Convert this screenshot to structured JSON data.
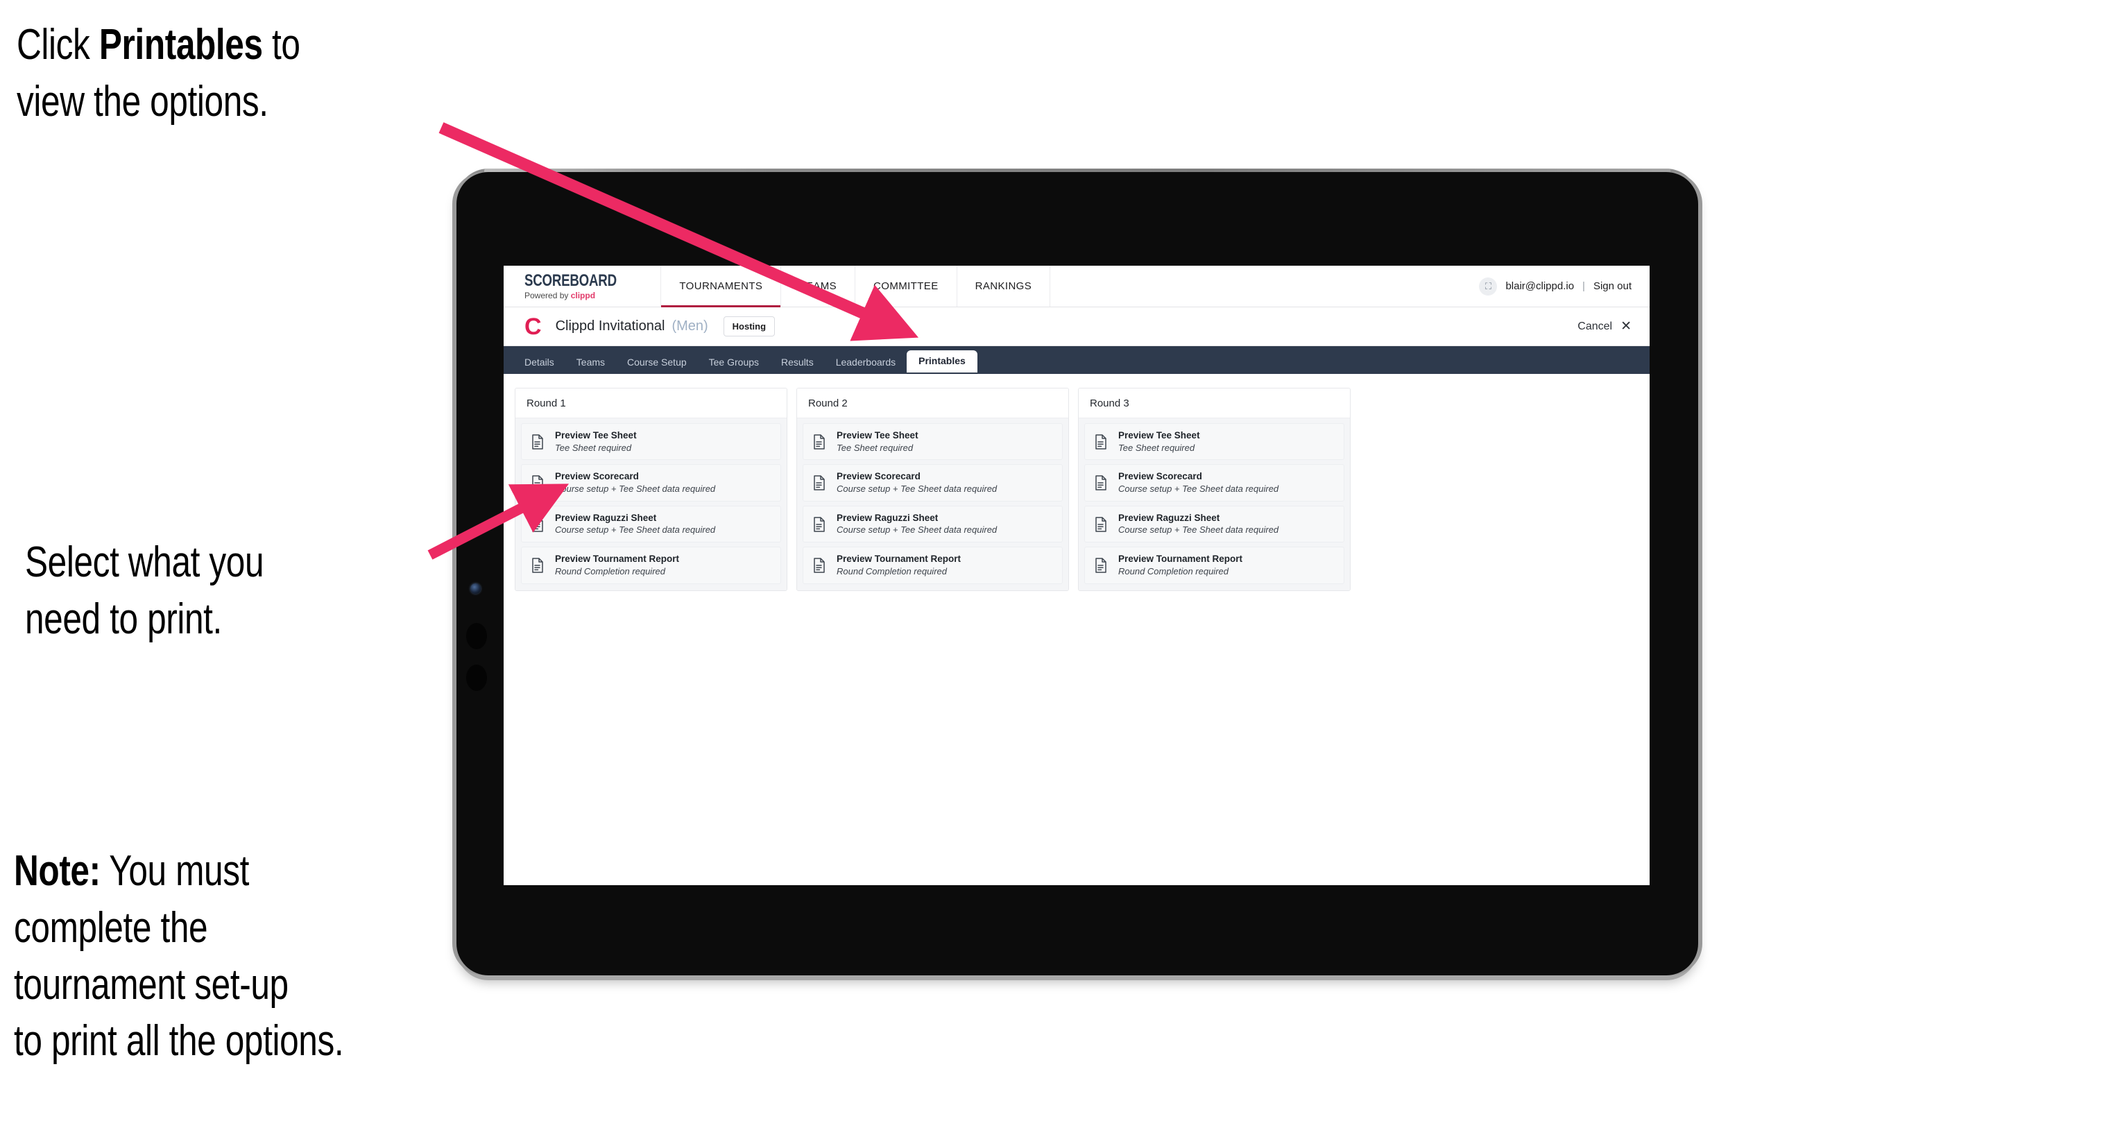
{
  "annotations": [
    {
      "id": "a1",
      "before": "Click ",
      "bold": "Printables",
      "after": " to\nview the options."
    },
    {
      "id": "a2",
      "before": "",
      "bold": "",
      "after": "Select what you\n need to print."
    },
    {
      "id": "a3",
      "before": "",
      "bold": "Note:",
      "after": " You must\ncomplete the\ntournament set-up\nto print all the options."
    }
  ],
  "annotation_color": "#000000",
  "arrow_color": "#ec2a63",
  "browser": {
    "topbar": {
      "brand_name": "SCOREBOARD",
      "brand_sub_prefix": "Powered by ",
      "brand_sub_accent": "clippd",
      "nav": [
        {
          "label": "TOURNAMENTS",
          "active": true
        },
        {
          "label": "TEAMS",
          "active": false
        },
        {
          "label": "COMMITTEE",
          "active": false
        },
        {
          "label": "RANKINGS",
          "active": false
        }
      ],
      "avatar_glyph": "⛶",
      "user_email": "blair@clippd.io",
      "separator": "|",
      "sign_out": "Sign out"
    },
    "titlebar": {
      "logo_letter": "C",
      "tournament_name": "Clippd Invitational",
      "gender": "(Men)",
      "badge": "Hosting",
      "cancel_label": "Cancel",
      "close_glyph": "✕"
    },
    "tabs": [
      {
        "label": "Details",
        "active": false
      },
      {
        "label": "Teams",
        "active": false
      },
      {
        "label": "Course Setup",
        "active": false
      },
      {
        "label": "Tee Groups",
        "active": false
      },
      {
        "label": "Results",
        "active": false
      },
      {
        "label": "Leaderboards",
        "active": false
      },
      {
        "label": "Printables",
        "active": true
      }
    ],
    "rounds": [
      {
        "title": "Round 1",
        "items": [
          {
            "title": "Preview Tee Sheet",
            "sub": "Tee Sheet required"
          },
          {
            "title": "Preview Scorecard",
            "sub": "Course setup + Tee Sheet data required"
          },
          {
            "title": "Preview Raguzzi Sheet",
            "sub": "Course setup + Tee Sheet data required"
          },
          {
            "title": "Preview Tournament Report",
            "sub": "Round Completion required"
          }
        ]
      },
      {
        "title": "Round 2",
        "items": [
          {
            "title": "Preview Tee Sheet",
            "sub": "Tee Sheet required"
          },
          {
            "title": "Preview Scorecard",
            "sub": "Course setup + Tee Sheet data required"
          },
          {
            "title": "Preview Raguzzi Sheet",
            "sub": "Course setup + Tee Sheet data required"
          },
          {
            "title": "Preview Tournament Report",
            "sub": "Round Completion required"
          }
        ]
      },
      {
        "title": "Round 3",
        "items": [
          {
            "title": "Preview Tee Sheet",
            "sub": "Tee Sheet required"
          },
          {
            "title": "Preview Scorecard",
            "sub": "Course setup + Tee Sheet data required"
          },
          {
            "title": "Preview Raguzzi Sheet",
            "sub": "Course setup + Tee Sheet data required"
          },
          {
            "title": "Preview Tournament Report",
            "sub": "Round Completion required"
          }
        ]
      }
    ]
  }
}
